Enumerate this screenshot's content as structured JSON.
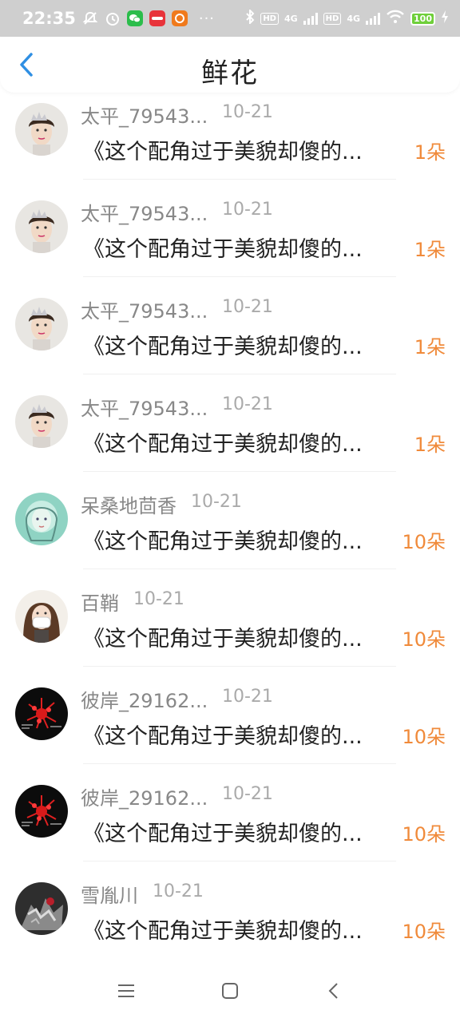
{
  "status_bar": {
    "time": "22:35",
    "icons": [
      "mute-icon",
      "alarm-icon",
      "wechat-icon",
      "app-icon",
      "taobao-icon"
    ],
    "more": "···",
    "hd1": "HD",
    "sig1": "4G",
    "hd2": "HD",
    "sig2": "4G",
    "battery": "100"
  },
  "header": {
    "title": "鲜花",
    "back_icon": "chevron-left-icon",
    "accent": "#2f8fe3"
  },
  "items": [
    {
      "name": "太平_79543...",
      "date": "10-21",
      "message": "《这个配角过于美貌却傻的...",
      "count": "1朵",
      "avatar": "face-a"
    },
    {
      "name": "太平_79543...",
      "date": "10-21",
      "message": "《这个配角过于美貌却傻的...",
      "count": "1朵",
      "avatar": "face-a"
    },
    {
      "name": "太平_79543...",
      "date": "10-21",
      "message": "《这个配角过于美貌却傻的...",
      "count": "1朵",
      "avatar": "face-a"
    },
    {
      "name": "太平_79543...",
      "date": "10-21",
      "message": "《这个配角过于美貌却傻的...",
      "count": "1朵",
      "avatar": "face-a"
    },
    {
      "name": "呆桑地茴香",
      "date": "10-21",
      "message": "《这个配角过于美貌却傻的...",
      "count": "10朵",
      "avatar": "face-teal"
    },
    {
      "name": "百鞘",
      "date": "10-21",
      "message": "《这个配角过于美貌却傻的...",
      "count": "10朵",
      "avatar": "face-mask"
    },
    {
      "name": "彼岸_29162...",
      "date": "10-21",
      "message": "《这个配角过于美貌却傻的...",
      "count": "10朵",
      "avatar": "flower-red"
    },
    {
      "name": "彼岸_29162...",
      "date": "10-21",
      "message": "《这个配角过于美貌却傻的...",
      "count": "10朵",
      "avatar": "flower-red"
    },
    {
      "name": "雪胤川",
      "date": "10-21",
      "message": "《这个配角过于美貌却傻的...",
      "count": "10朵",
      "avatar": "dark-art"
    }
  ],
  "count_color": "#f08a3a",
  "nav_bar": {
    "buttons": [
      "menu-icon",
      "home-square-icon",
      "back-triangle-icon"
    ]
  }
}
